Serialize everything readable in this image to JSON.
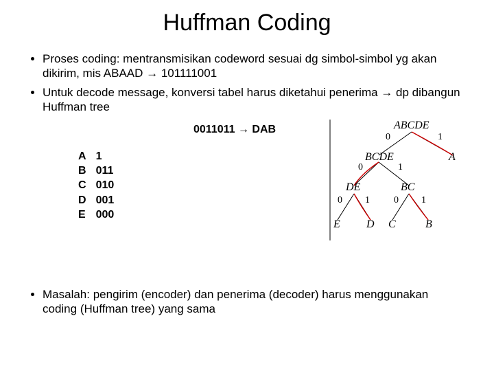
{
  "title": "Huffman Coding",
  "bullets_top": [
    "Proses coding: mentransmisikan codeword sesuai dg simbol-simbol yg akan dikirim, mis ABAAD → 101111001",
    "Untuk decode message, konversi tabel harus diketahui penerima → dp dibangun Huffman tree"
  ],
  "decode_example": "0011011 → DAB",
  "code_table": [
    {
      "sym": "A",
      "code": "1"
    },
    {
      "sym": "B",
      "code": "011"
    },
    {
      "sym": "C",
      "code": "010"
    },
    {
      "sym": "D",
      "code": "001"
    },
    {
      "sym": "E",
      "code": "000"
    }
  ],
  "tree": {
    "nodes": {
      "root": "ABCDE",
      "bcde": "BCDE",
      "a": "A",
      "de": "DE",
      "bc": "BC",
      "e": "E",
      "d": "D",
      "c": "C",
      "b": "B"
    },
    "bits": {
      "root_l": "0",
      "root_r": "1",
      "bcde_l": "0",
      "bcde_r": "1",
      "de_l": "0",
      "de_r": "1",
      "bc_l": "0",
      "bc_r": "1"
    }
  },
  "bullets_bottom": [
    "Masalah: pengirim (encoder) dan penerima (decoder) harus menggunakan coding (Huffman tree) yang sama"
  ]
}
